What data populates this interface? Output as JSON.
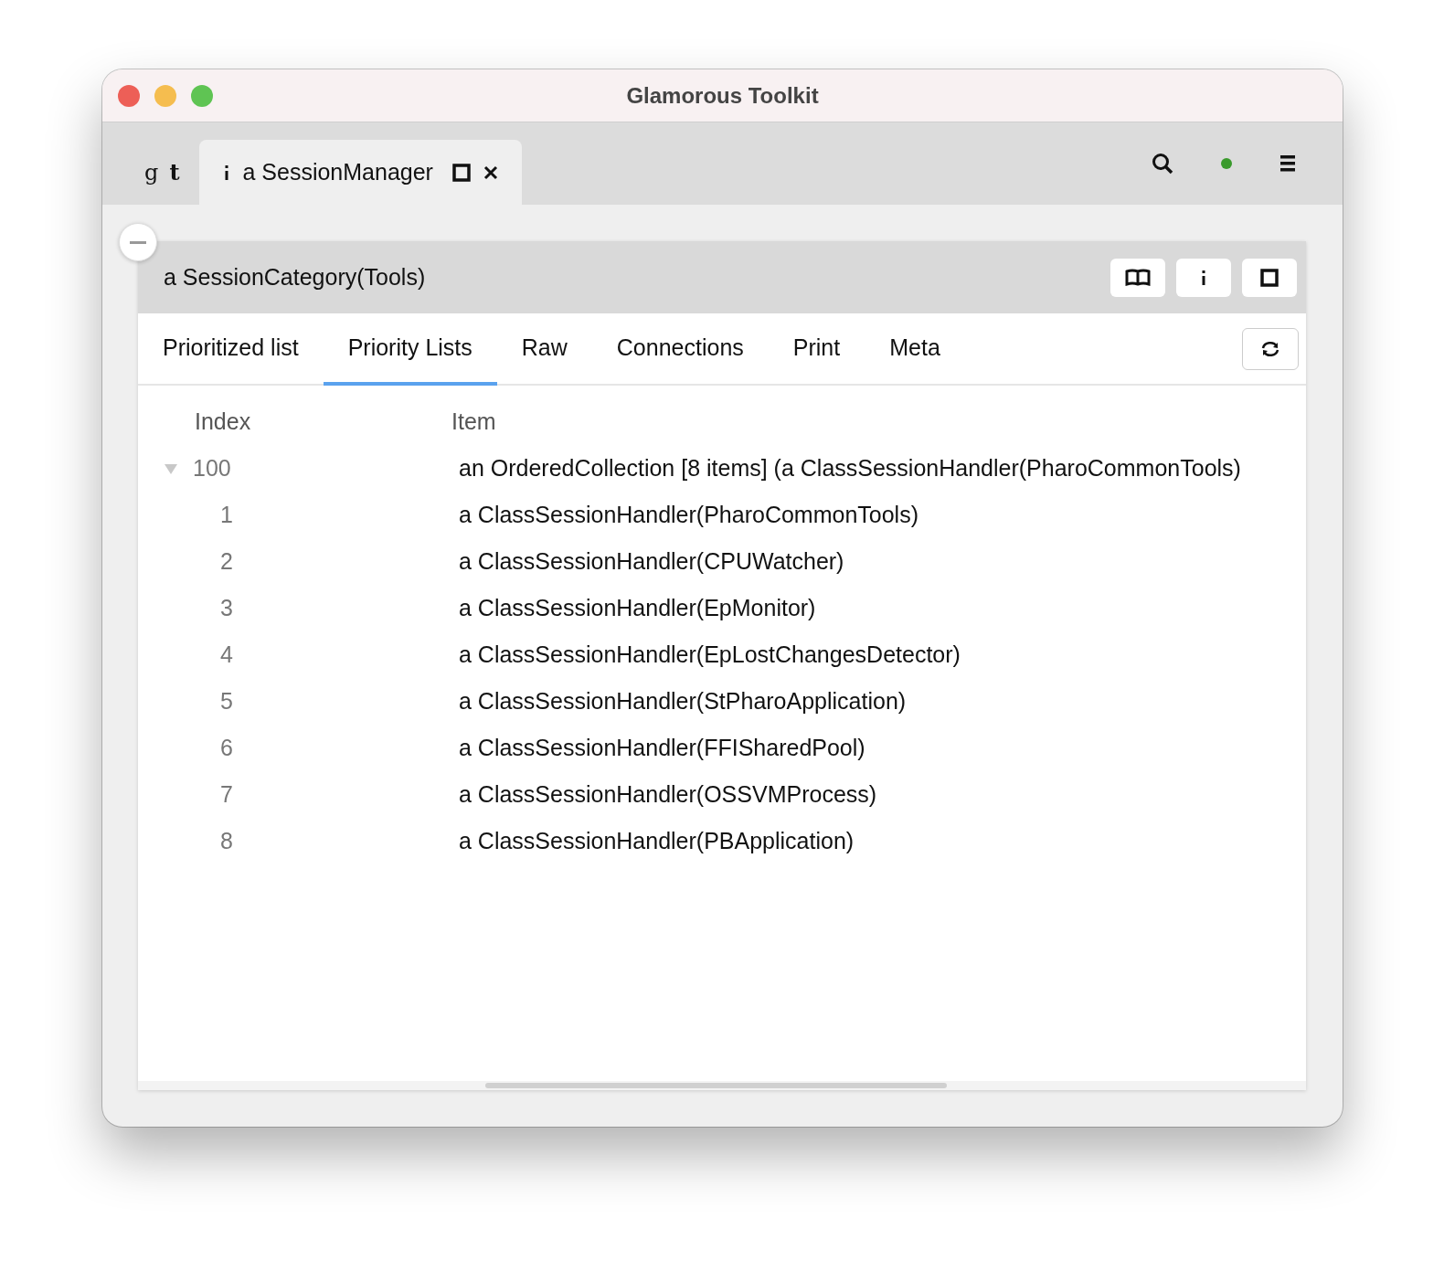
{
  "window": {
    "title": "Glamorous Toolkit"
  },
  "top_tabs": [
    {
      "label": "g**t**",
      "kind": "logo",
      "selected": false
    },
    {
      "label": "a SessionManager",
      "kind": "inspector",
      "selected": true
    }
  ],
  "inspector": {
    "title": "a SessionCategory(Tools)",
    "view_tabs": [
      {
        "label": "Prioritized list",
        "selected": false
      },
      {
        "label": "Priority Lists",
        "selected": true
      },
      {
        "label": "Raw",
        "selected": false
      },
      {
        "label": "Connections",
        "selected": false
      },
      {
        "label": "Print",
        "selected": false
      },
      {
        "label": "Meta",
        "selected": false
      }
    ],
    "table": {
      "columns": [
        "Index",
        "Item"
      ],
      "rows": [
        {
          "index": "100",
          "item": "an OrderedCollection [8 items] (a ClassSessionHandler(PharoCommonTools)",
          "expanded": true,
          "children": [
            {
              "index": "1",
              "item": "a ClassSessionHandler(PharoCommonTools)"
            },
            {
              "index": "2",
              "item": "a ClassSessionHandler(CPUWatcher)"
            },
            {
              "index": "3",
              "item": "a ClassSessionHandler(EpMonitor)"
            },
            {
              "index": "4",
              "item": "a ClassSessionHandler(EpLostChangesDetector)"
            },
            {
              "index": "5",
              "item": "a ClassSessionHandler(StPharoApplication)"
            },
            {
              "index": "6",
              "item": "a ClassSessionHandler(FFISharedPool)"
            },
            {
              "index": "7",
              "item": "a ClassSessionHandler(OSSVMProcess)"
            },
            {
              "index": "8",
              "item": "a ClassSessionHandler(PBApplication)"
            }
          ]
        }
      ]
    }
  }
}
